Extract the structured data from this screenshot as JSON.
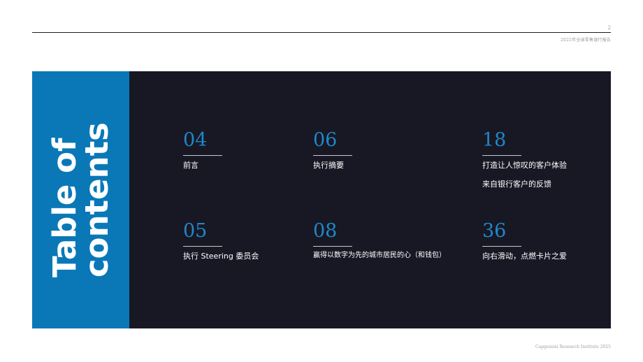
{
  "header": {
    "page_number": "2",
    "report_title": "2025年全球零售银行报告"
  },
  "sidebar": {
    "title_line1": "Table of",
    "title_line2": "contents"
  },
  "toc": [
    {
      "num": "04",
      "label": "前言"
    },
    {
      "num": "06",
      "label": "执行摘要"
    },
    {
      "num": "18",
      "label": "打造让人惊叹的客户体验",
      "label2": "来自银行客户的反馈"
    },
    {
      "num": "05",
      "label": "执行 Steering 委员会"
    },
    {
      "num": "08",
      "label": "赢得以数字为先的城市居民的心（和钱包）"
    },
    {
      "num": "36",
      "label": "向右滑动，点燃卡片之爱"
    }
  ],
  "footer": {
    "text": "Capgemini Research Institute 2025"
  },
  "colors": {
    "accent_blue": "#0a78b7",
    "number_blue": "#1e88c9",
    "panel_dark": "#181724"
  }
}
